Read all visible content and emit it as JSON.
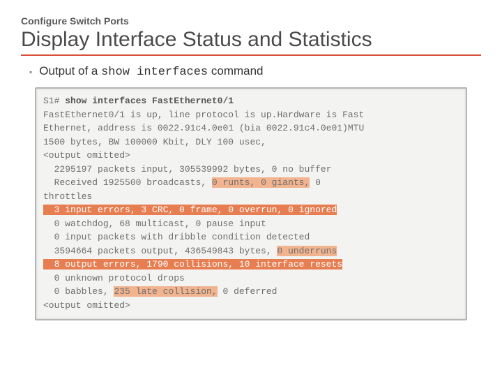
{
  "kicker": "Configure Switch Ports",
  "title": "Display Interface Status and Statistics",
  "bullet": {
    "prefix": "Output of a ",
    "cmd": "show interfaces",
    "suffix": " command"
  },
  "terminal": {
    "prompt": "S1# ",
    "command": "show interfaces FastEthernet0/1",
    "l1": "FastEthernet0/1 is up, line protocol is up.Hardware is Fast",
    "l2": "Ethernet, address is 0022.91c4.0e01 (bia 0022.91c4.0e01)MTU",
    "l3": "1500 bytes, BW 100000 Kbit, DLY 100 usec,",
    "om1": "<output omitted>",
    "l4": "  2295197 packets input, 305539992 bytes, 0 no buffer",
    "l5a": "  Received 1925500 broadcasts, ",
    "l5hl": "0 runts, 0 giants,",
    "l5b": " 0",
    "l6": "throttles",
    "l7": "  3 input errors, 3 CRC, 0 frame, 0 overrun, 0 ignored",
    "l8": "  0 watchdog, 68 multicast, 0 pause input",
    "l9": "  0 input packets with dribble condition detected",
    "l10a": "  3594664 packets output, 436549843 bytes, ",
    "l10hl": "0 underruns",
    "l11": "  8 output errors, 1790 collisions, 10 interface resets",
    "l12": "  0 unknown protocol drops",
    "l13a": "  0 babbles, ",
    "l13hl": "235 late collision,",
    "l13b": " 0 deferred",
    "om2": "<output omitted>"
  }
}
